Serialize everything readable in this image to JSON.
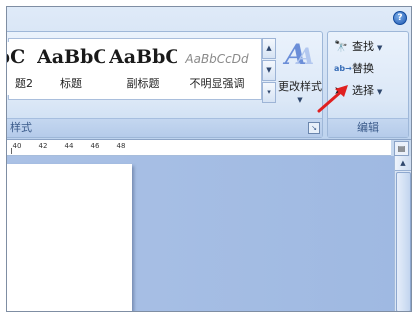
{
  "ribbon": {
    "help_icon": "?",
    "styles_group": {
      "label": "样式",
      "gallery": [
        {
          "sample": "bC",
          "name": "题2"
        },
        {
          "sample": "AaBbC",
          "name": "标题"
        },
        {
          "sample": "AaBbC",
          "name": "副标题"
        },
        {
          "sample": "AaBbCcDd",
          "name": "不明显强调"
        }
      ],
      "change_styles_label": "更改样式"
    },
    "edit_group": {
      "label": "编辑",
      "find_label": "查找",
      "replace_label": "替换",
      "select_label": "选择"
    }
  },
  "ruler": {
    "ticks": [
      "40",
      "42",
      "44",
      "46",
      "48"
    ]
  },
  "annotation": {
    "color": "#e02020"
  }
}
